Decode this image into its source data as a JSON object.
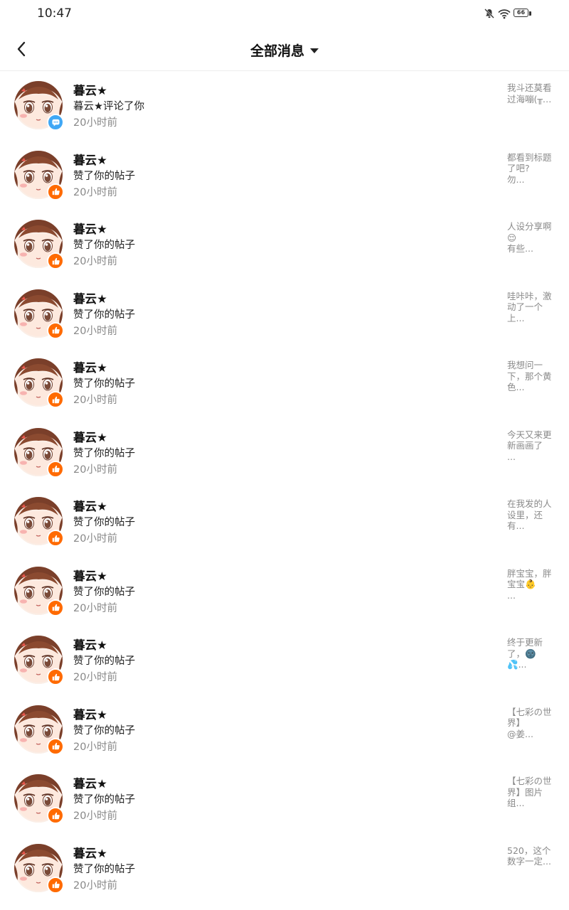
{
  "status_bar": {
    "time": "10:47",
    "battery_level": "66",
    "icons": [
      "mute-bell-icon",
      "wifi-icon",
      "battery-icon"
    ]
  },
  "header": {
    "title": "全部消息",
    "back_icon": "chevron-left-icon",
    "dropdown_icon": "caret-down-icon"
  },
  "colors": {
    "like_badge": "#ff6a00",
    "comment_badge": "#3fa7f5",
    "time_text": "#888888"
  },
  "messages": [
    {
      "name": "暮云★",
      "action": "暮云★评论了你",
      "time": "20小时前",
      "preview": "我斗还莫看\n过海嘣(╥…",
      "type": "comment"
    },
    {
      "name": "暮云★",
      "action": "赞了你的帖子",
      "time": "20小时前",
      "preview": "都看到标题\n了吧?\n勿...",
      "type": "like"
    },
    {
      "name": "暮云★",
      "action": "赞了你的帖子",
      "time": "20小时前",
      "preview": "人设分享啊\n😌\n有些...",
      "type": "like"
    },
    {
      "name": "暮云★",
      "action": "赞了你的帖子",
      "time": "20小时前",
      "preview": "哇咔咔，激\n动了一个\n上...",
      "type": "like"
    },
    {
      "name": "暮云★",
      "action": "赞了你的帖子",
      "time": "20小时前",
      "preview": "我想问一\n下，那个黄\n色...",
      "type": "like"
    },
    {
      "name": "暮云★",
      "action": "赞了你的帖子",
      "time": "20小时前",
      "preview": "今天又来更\n新画画了\n...",
      "type": "like"
    },
    {
      "name": "暮云★",
      "action": "赞了你的帖子",
      "time": "20小时前",
      "preview": "在我发的人\n设里，还\n有...",
      "type": "like"
    },
    {
      "name": "暮云★",
      "action": "赞了你的帖子",
      "time": "20小时前",
      "preview": "胖宝宝，胖\n宝宝👶\n...",
      "type": "like"
    },
    {
      "name": "暮云★",
      "action": "赞了你的帖子",
      "time": "20小时前",
      "preview": "终于更新\n了，🌚💦...",
      "type": "like"
    },
    {
      "name": "暮云★",
      "action": "赞了你的帖子",
      "time": "20小时前",
      "preview": "【七彩の世\n界】\n@姜...",
      "type": "like"
    },
    {
      "name": "暮云★",
      "action": "赞了你的帖子",
      "time": "20小时前",
      "preview": "【七彩の世\n界】图片\n组...",
      "type": "like"
    },
    {
      "name": "暮云★",
      "action": "赞了你的帖子",
      "time": "20小时前",
      "preview": "520，这个\n数字一定...",
      "type": "like"
    }
  ]
}
